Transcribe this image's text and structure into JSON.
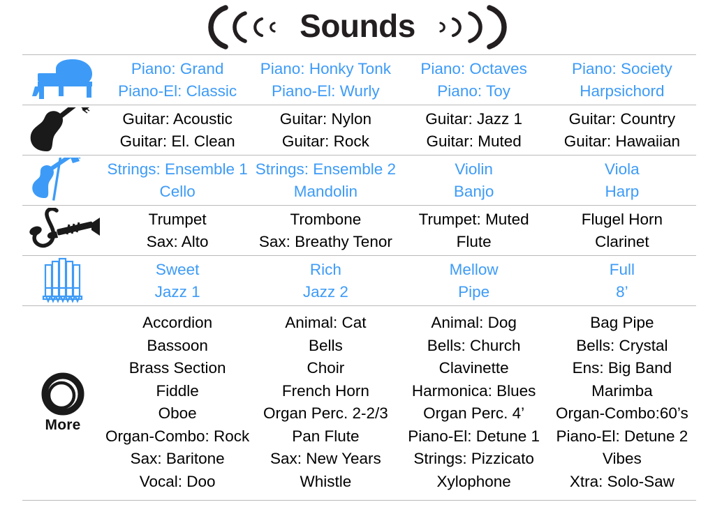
{
  "header": {
    "title": "Sounds",
    "left_decoration": "sound-wave-left",
    "right_decoration": "sound-wave-right"
  },
  "colors": {
    "blue": "#3d9bf7",
    "black": "#000000",
    "divider": "#b9b9b9",
    "background": "#ffffff"
  },
  "table": {
    "column_count": 4,
    "rows": [
      {
        "icon": "grand-piano-icon",
        "icon_color": "#3d9bf7",
        "text_color": "blue",
        "columns": [
          [
            "Piano: Grand",
            "Piano-El: Classic"
          ],
          [
            "Piano: Honky Tonk",
            "Piano-El: Wurly"
          ],
          [
            "Piano: Octaves",
            "Piano: Toy"
          ],
          [
            "Piano: Society",
            "Harpsichord"
          ]
        ]
      },
      {
        "icon": "acoustic-guitar-icon",
        "icon_color": "#1a1a1a",
        "text_color": "black",
        "columns": [
          [
            "Guitar: Acoustic",
            "Guitar: El. Clean"
          ],
          [
            "Guitar: Nylon",
            "Guitar: Rock"
          ],
          [
            "Guitar: Jazz 1",
            "Guitar: Muted"
          ],
          [
            "Guitar: Country",
            "Guitar: Hawaiian"
          ]
        ]
      },
      {
        "icon": "violin-icon",
        "icon_color": "#3d9bf7",
        "text_color": "blue",
        "columns": [
          [
            "Strings: Ensemble 1",
            "Cello"
          ],
          [
            "Strings: Ensemble 2",
            "Mandolin"
          ],
          [
            "Violin",
            "Banjo"
          ],
          [
            "Viola",
            "Harp"
          ]
        ]
      },
      {
        "icon": "saxophone-trumpet-icon",
        "icon_color": "#1a1a1a",
        "text_color": "black",
        "columns": [
          [
            "Trumpet",
            "Sax: Alto"
          ],
          [
            "Trombone",
            "Sax: Breathy Tenor"
          ],
          [
            "Trumpet: Muted",
            "Flute"
          ],
          [
            "Flugel Horn",
            "Clarinet"
          ]
        ]
      },
      {
        "icon": "pipe-organ-icon",
        "icon_color": "#3d9bf7",
        "text_color": "blue",
        "columns": [
          [
            "Sweet",
            "Jazz 1"
          ],
          [
            "Rich",
            "Jazz 2"
          ],
          [
            "Mellow",
            "Pipe"
          ],
          [
            "Full",
            "8’"
          ]
        ]
      },
      {
        "icon": "more-ring-icon",
        "icon_color": "#1a1a1a",
        "icon_label": "More",
        "text_color": "black",
        "columns": [
          [
            "Accordion",
            "Bassoon",
            "Brass Section",
            "Fiddle",
            "Oboe",
            "Organ-Combo: Rock",
            "Sax: Baritone",
            "Vocal: Doo"
          ],
          [
            "Animal: Cat",
            "Bells",
            "Choir",
            "French Horn",
            "Organ Perc. 2-2/3",
            "Pan Flute",
            "Sax: New Years",
            "Whistle"
          ],
          [
            "Animal: Dog",
            "Bells: Church",
            "Clavinette",
            "Harmonica: Blues",
            "Organ Perc. 4’",
            "Piano-El: Detune 1",
            "Strings: Pizzicato",
            "Xylophone"
          ],
          [
            "Bag Pipe",
            "Bells: Crystal",
            "Ens: Big Band",
            "Marimba",
            "Organ-Combo:60’s",
            "Piano-El: Detune 2",
            "Vibes",
            "Xtra: Solo-Saw"
          ]
        ]
      }
    ]
  }
}
